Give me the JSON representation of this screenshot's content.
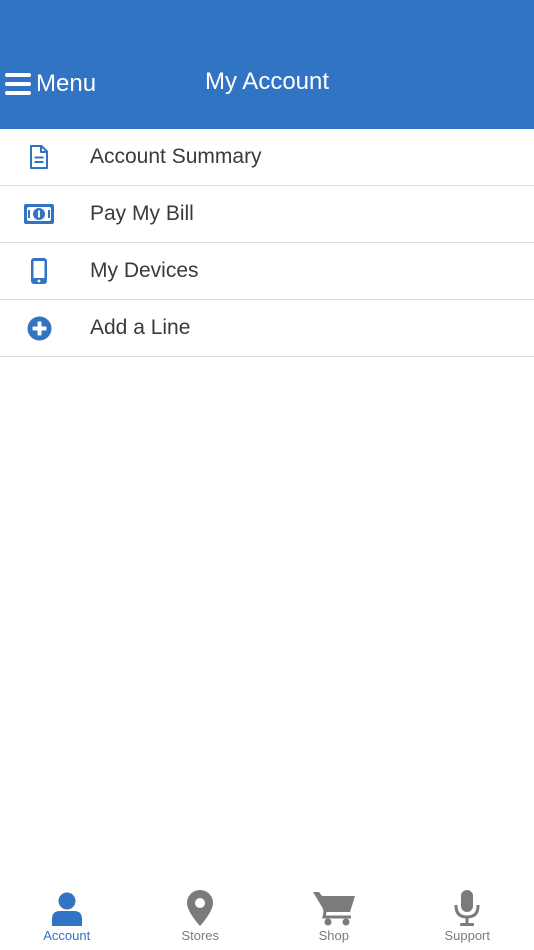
{
  "colors": {
    "brand": "#3174c4",
    "inactive": "#7b7b7b",
    "text": "#3a3a3a"
  },
  "header": {
    "menu_label": "Menu",
    "title": "My Account"
  },
  "items": [
    {
      "label": "Account Summary",
      "icon": "document-icon"
    },
    {
      "label": "Pay My Bill",
      "icon": "money-icon"
    },
    {
      "label": "My Devices",
      "icon": "phone-icon"
    },
    {
      "label": "Add a Line",
      "icon": "plus-circle-icon"
    }
  ],
  "tabs": [
    {
      "label": "Account",
      "icon": "person-icon",
      "active": true
    },
    {
      "label": "Stores",
      "icon": "location-pin-icon",
      "active": false
    },
    {
      "label": "Shop",
      "icon": "cart-icon",
      "active": false
    },
    {
      "label": "Support",
      "icon": "microphone-icon",
      "active": false
    }
  ]
}
